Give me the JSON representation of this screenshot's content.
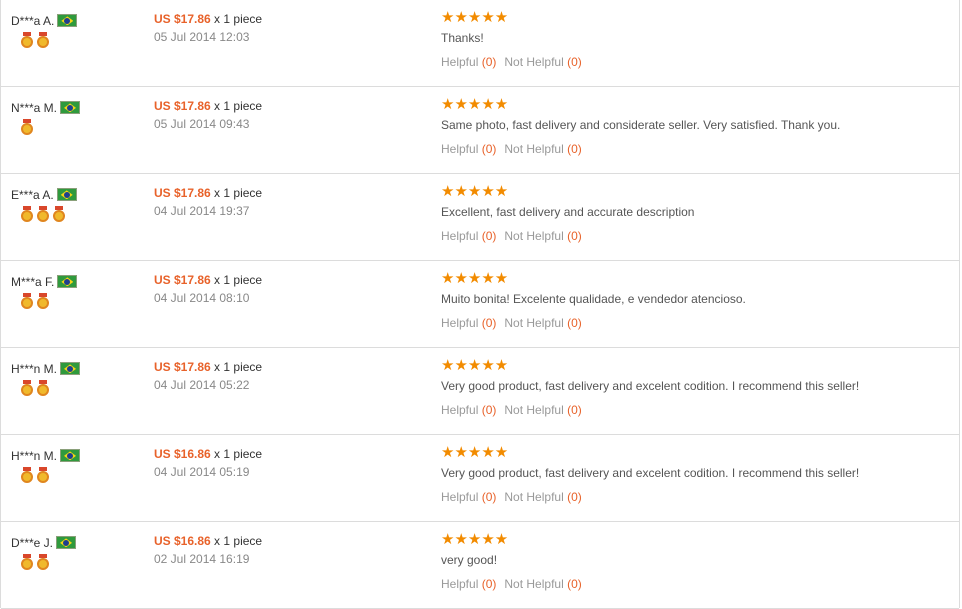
{
  "helpful_label": "Helpful",
  "not_helpful_label": "Not Helpful",
  "stars": "★★★★★",
  "reviews": [
    {
      "buyer": "D***a A.",
      "medals": 2,
      "price": "US $17.86",
      "qty": " x 1 piece",
      "date": "05 Jul 2014 12:03",
      "text": "Thanks!",
      "helpful": "(0)",
      "not_helpful": "(0)"
    },
    {
      "buyer": "N***a M.",
      "medals": 1,
      "price": "US $17.86",
      "qty": " x 1 piece",
      "date": "05 Jul 2014 09:43",
      "text": "Same photo, fast delivery and considerate seller. Very satisfied. Thank you.",
      "helpful": "(0)",
      "not_helpful": "(0)"
    },
    {
      "buyer": "E***a A.",
      "medals": 3,
      "price": "US $17.86",
      "qty": " x 1 piece",
      "date": "04 Jul 2014 19:37",
      "text": "Excellent, fast delivery and accurate description",
      "helpful": "(0)",
      "not_helpful": "(0)"
    },
    {
      "buyer": "M***a F.",
      "medals": 2,
      "price": "US $17.86",
      "qty": " x 1 piece",
      "date": "04 Jul 2014 08:10",
      "text": "Muito bonita! Excelente qualidade, e vendedor atencioso.",
      "helpful": "(0)",
      "not_helpful": "(0)"
    },
    {
      "buyer": "H***n M.",
      "medals": 2,
      "price": "US $17.86",
      "qty": " x 1 piece",
      "date": "04 Jul 2014 05:22",
      "text": "Very good product, fast delivery and excelent codition. I recommend this seller!",
      "helpful": "(0)",
      "not_helpful": "(0)"
    },
    {
      "buyer": "H***n M.",
      "medals": 2,
      "price": "US $16.86",
      "qty": " x 1 piece",
      "date": "04 Jul 2014 05:19",
      "text": "Very good product, fast delivery and excelent codition. I recommend this seller!",
      "helpful": "(0)",
      "not_helpful": "(0)"
    },
    {
      "buyer": "D***e J.",
      "medals": 2,
      "price": "US $16.86",
      "qty": " x 1 piece",
      "date": "02 Jul 2014 16:19",
      "text": "very good!",
      "helpful": "(0)",
      "not_helpful": "(0)"
    }
  ]
}
